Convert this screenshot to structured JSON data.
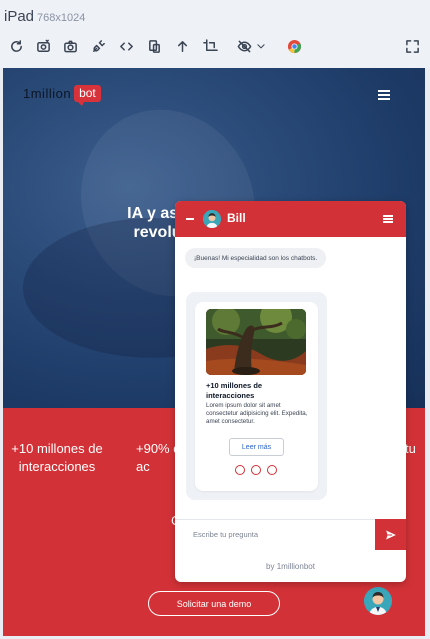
{
  "device": {
    "name": "iPad",
    "dimensions": "768x1024"
  },
  "toolbar": {
    "icons": [
      "refresh-icon",
      "screenshot-settings-icon",
      "camera-icon",
      "plug-icon",
      "code-icon",
      "copy-device-icon",
      "upload-icon",
      "crop-icon",
      "hide-icon",
      "chevron-down-icon",
      "chrome-icon",
      "fullscreen-icon"
    ]
  },
  "site": {
    "logo_text": "1million",
    "logo_badge": "bot",
    "hero_title": "IA y asist\nrevoluc",
    "stats": [
      {
        "label": "+10 millones de\ninteracciones"
      },
      {
        "label": "+90% d\nac"
      },
      {
        "label": "tu"
      }
    ],
    "cta_label": "Solicitar una demo",
    "partial_text": "C"
  },
  "chat": {
    "bot_name": "Bill",
    "greeting": "¡Buenas! Mi especialidad son los chatbots.",
    "card": {
      "title": "+10 millones de interacciones",
      "text": "Lorem ipsum dolor sit amet consectetur adipisicing elit. Expedita, amet consectetur.",
      "button_label": "Leer más"
    },
    "input_placeholder": "Escribe tu pregunta",
    "footer": "by 1millionbot"
  },
  "colors": {
    "brand_red": "#d23237",
    "hero_blue": "#1f3d6b",
    "link_blue": "#2b63c6"
  }
}
